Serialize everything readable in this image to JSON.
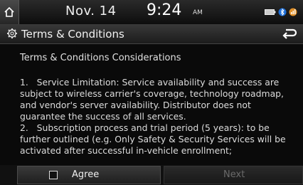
{
  "status_bar": {
    "date": "Nov. 14",
    "time": "9:24",
    "ampm": "AM",
    "icons": [
      "home-icon",
      "battery-icon",
      "bluetooth-icon",
      "signal-icon"
    ]
  },
  "title_bar": {
    "title": "Terms & Conditions",
    "icons": [
      "gear-icon",
      "back-arrow-icon"
    ]
  },
  "content": {
    "heading": "Terms & Conditions Considerations",
    "body": "1.   Service Limitation: Service availability and success are subject to wireless carrier's coverage, technology roadmap, and vendor's server availability. Distributor does not guarantee the success of all services.\n2.   Subscription process and trial period (5 years): to be further outlined (e.g. Only Safety & Security Services will be activated after successful in-vehicle enrollment;"
  },
  "buttons": {
    "agree_label": "Agree",
    "agree_checked": false,
    "next_label": "Next",
    "next_enabled": false
  }
}
